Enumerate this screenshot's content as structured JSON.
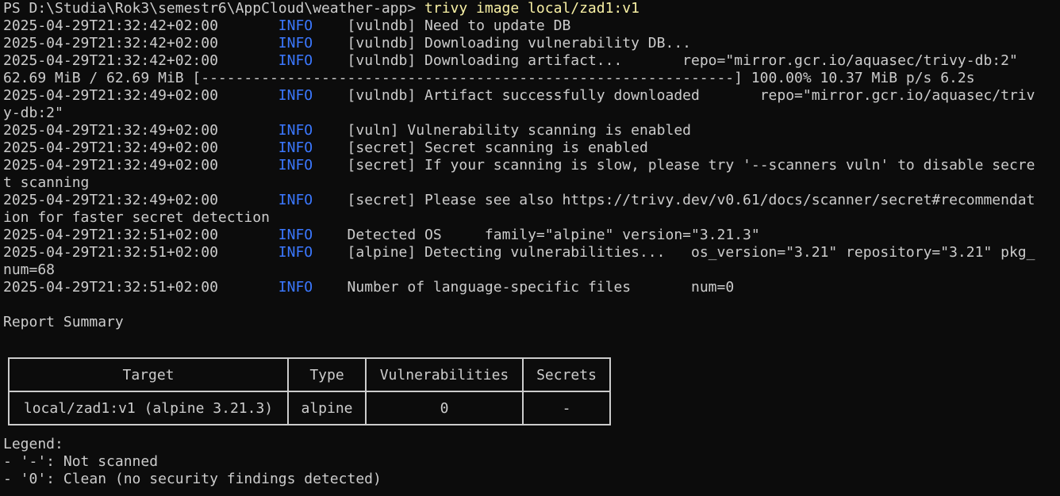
{
  "prompt": {
    "path": "PS D:\\Studia\\Rok3\\semestr6\\AppCloud\\weather-app> ",
    "command": "trivy image local/zad1:v1"
  },
  "log": [
    {
      "ts": "2025-04-29T21:32:42+02:00",
      "level": "INFO",
      "msg": "[vulndb] Need to update DB"
    },
    {
      "ts": "2025-04-29T21:32:42+02:00",
      "level": "INFO",
      "msg": "[vulndb] Downloading vulnerability DB..."
    },
    {
      "ts": "2025-04-29T21:32:42+02:00",
      "level": "INFO",
      "msg": "[vulndb] Downloading artifact...       repo=\"mirror.gcr.io/aquasec/trivy-db:2\""
    },
    {
      "raw": "62.69 MiB / 62.69 MiB [--------------------------------------------------------------] 100.00% 10.37 MiB p/s 6.2s"
    },
    {
      "ts": "2025-04-29T21:32:49+02:00",
      "level": "INFO",
      "msg": "[vulndb] Artifact successfully downloaded       repo=\"mirror.gcr.io/aquasec/triv"
    },
    {
      "raw": "y-db:2\""
    },
    {
      "ts": "2025-04-29T21:32:49+02:00",
      "level": "INFO",
      "msg": "[vuln] Vulnerability scanning is enabled"
    },
    {
      "ts": "2025-04-29T21:32:49+02:00",
      "level": "INFO",
      "msg": "[secret] Secret scanning is enabled"
    },
    {
      "ts": "2025-04-29T21:32:49+02:00",
      "level": "INFO",
      "msg": "[secret] If your scanning is slow, please try '--scanners vuln' to disable secre"
    },
    {
      "raw": "t scanning"
    },
    {
      "ts": "2025-04-29T21:32:49+02:00",
      "level": "INFO",
      "msg": "[secret] Please see also https://trivy.dev/v0.61/docs/scanner/secret#recommendat"
    },
    {
      "raw": "ion for faster secret detection"
    },
    {
      "ts": "2025-04-29T21:32:51+02:00",
      "level": "INFO",
      "msg": "Detected OS     family=\"alpine\" version=\"3.21.3\""
    },
    {
      "ts": "2025-04-29T21:32:51+02:00",
      "level": "INFO",
      "msg": "[alpine] Detecting vulnerabilities...   os_version=\"3.21\" repository=\"3.21\" pkg_"
    },
    {
      "raw": "num=68"
    },
    {
      "ts": "2025-04-29T21:32:51+02:00",
      "level": "INFO",
      "msg": "Number of language-specific files       num=0"
    }
  ],
  "report": {
    "title": "Report Summary",
    "headers": [
      "Target",
      "Type",
      "Vulnerabilities",
      "Secrets"
    ],
    "rows": [
      [
        "local/zad1:v1 (alpine 3.21.3)",
        "alpine",
        "0",
        "-"
      ]
    ]
  },
  "legend": {
    "title": "Legend:",
    "items": [
      "- '-': Not scanned",
      "- '0': Clean (no security findings detected)"
    ]
  },
  "colors": {
    "background": "#0c0c0c",
    "text": "#cccccc",
    "command": "#f9f1a5",
    "info": "#3b78ff"
  }
}
